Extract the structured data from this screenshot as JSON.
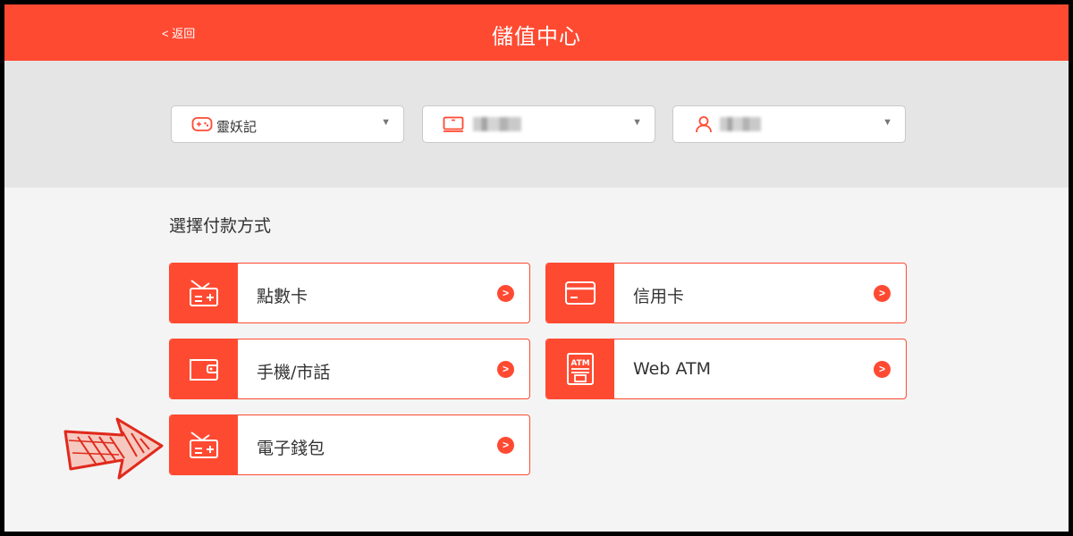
{
  "header": {
    "back_label": "< 返回",
    "title": "儲值中心"
  },
  "selectors": [
    {
      "icon": "gamepad-icon",
      "value": "靈妖記"
    },
    {
      "icon": "server-icon",
      "value": ""
    },
    {
      "icon": "user-icon",
      "value": ""
    }
  ],
  "payment": {
    "section_title": "選擇付款方式",
    "methods": [
      {
        "icon": "point-card-icon",
        "label": "點數卡"
      },
      {
        "icon": "credit-card-icon",
        "label": "信用卡"
      },
      {
        "icon": "wallet-icon",
        "label": "手機/市話"
      },
      {
        "icon": "atm-icon",
        "label": "Web ATM"
      },
      {
        "icon": "point-card-icon",
        "label": "電子錢包"
      }
    ]
  },
  "colors": {
    "brand": "#ff4a32",
    "select_bar": "#e5e5e5",
    "background": "#f4f4f4"
  }
}
